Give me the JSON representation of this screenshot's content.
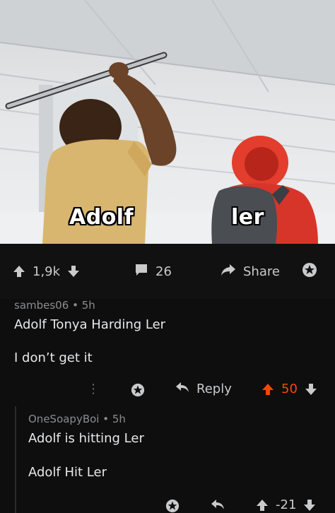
{
  "image": {
    "left_label": "Adolf",
    "right_label": "ler"
  },
  "post": {
    "score": "1,9k",
    "comments": "26",
    "share_label": "Share"
  },
  "comments": [
    {
      "author": "sambes06",
      "age": "5h",
      "lines": [
        "Adolf Tonya Harding Ler",
        "I don’t get it"
      ],
      "reply_label": "Reply",
      "score": "50",
      "upvoted": true
    },
    {
      "author": "OneSoapyBoi",
      "age": "5h",
      "lines": [
        "Adolf is hitting Ler",
        "Adolf Hit Ler"
      ],
      "score": "-21"
    }
  ],
  "colors": {
    "background": "#0e0e0f",
    "upvote_orange": "#ff4500",
    "text": "#d7dadc",
    "meta": "#8a8c8e"
  }
}
